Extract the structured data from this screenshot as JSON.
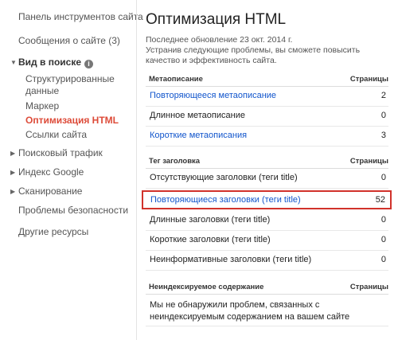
{
  "sidebar": {
    "dashboard": "Панель инструментов сайта",
    "messages": "Сообщения о сайте (3)",
    "search_appearance": "Вид в поиске",
    "structured_data_1": "Структурированные",
    "structured_data_2": "данные",
    "marker": "Маркер",
    "html_improvements": "Оптимизация HTML",
    "sitelinks": "Ссылки сайта",
    "search_traffic": "Поисковый трафик",
    "google_index": "Индекс Google",
    "crawl": "Сканирование",
    "security": "Проблемы безопасности",
    "other": "Другие ресурсы",
    "info_icon": "info-icon"
  },
  "main": {
    "title": "Оптимизация HTML",
    "last_updated": "Последнее обновление 23 окт. 2014 г.",
    "description": "Устранив следующие проблемы, вы сможете повысить качество и эффективность сайта.",
    "meta_section": {
      "header": "Метаописание",
      "pages_header": "Страницы",
      "rows": [
        {
          "label": "Повторяющееся метаописание",
          "count": "2"
        },
        {
          "label": "Длинное метаописание",
          "count": "0"
        },
        {
          "label": "Короткие метаописания",
          "count": "3"
        }
      ]
    },
    "title_section": {
      "header": "Тег заголовка",
      "pages_header": "Страницы",
      "rows": [
        {
          "label": "Отсутствующие заголовки (теги title)",
          "count": "0"
        },
        {
          "label": "Повторяющиеся заголовки (теги title)",
          "count": "52"
        },
        {
          "label": "Длинные заголовки (теги title)",
          "count": "0"
        },
        {
          "label": "Короткие заголовки (теги title)",
          "count": "0"
        },
        {
          "label": "Неинформативные заголовки (теги title)",
          "count": "0"
        }
      ]
    },
    "nonindexable_section": {
      "header": "Неиндексируемое содержание",
      "pages_header": "Страницы",
      "message": "Мы не обнаружили проблем, связанных с неиндексируемым содержанием на вашем сайте"
    }
  },
  "colors": {
    "link": "#1155cc",
    "active_nav": "#dd4b39",
    "highlight_border": "#d1322b"
  }
}
